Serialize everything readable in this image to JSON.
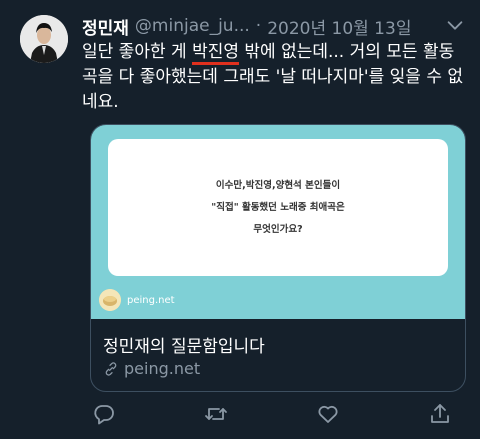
{
  "author": {
    "display_name": "정민재",
    "handle": "@minjae_ju...",
    "separator": "·",
    "date": "2020년 10월 13일"
  },
  "tweet": {
    "text_before": "일단 좋아한 게 ",
    "highlighted": "박진영",
    "text_after": " 밖에 없는데... 거의 모든 활동곡을 다 좋아했는데 그래도 '날 떠나지마'를 잊을 수 없네요."
  },
  "card": {
    "question_lines": [
      "이수만,박진영,양현석 본인들이",
      "\"직접\" 활동했던 노래중 최애곡은",
      "무엇인가요?"
    ],
    "brand": "peing.net",
    "title": "정민재의 질문함입니다",
    "link": "peing.net"
  },
  "colors": {
    "background": "#15202b",
    "card_image": "#7fd0d6",
    "underline": "#e0301e",
    "muted_text": "#8b98a5",
    "icon": "#8b98a5"
  },
  "icons": [
    "chevron-down-icon",
    "link-icon",
    "reply-icon",
    "retweet-icon",
    "like-icon",
    "share-icon"
  ]
}
